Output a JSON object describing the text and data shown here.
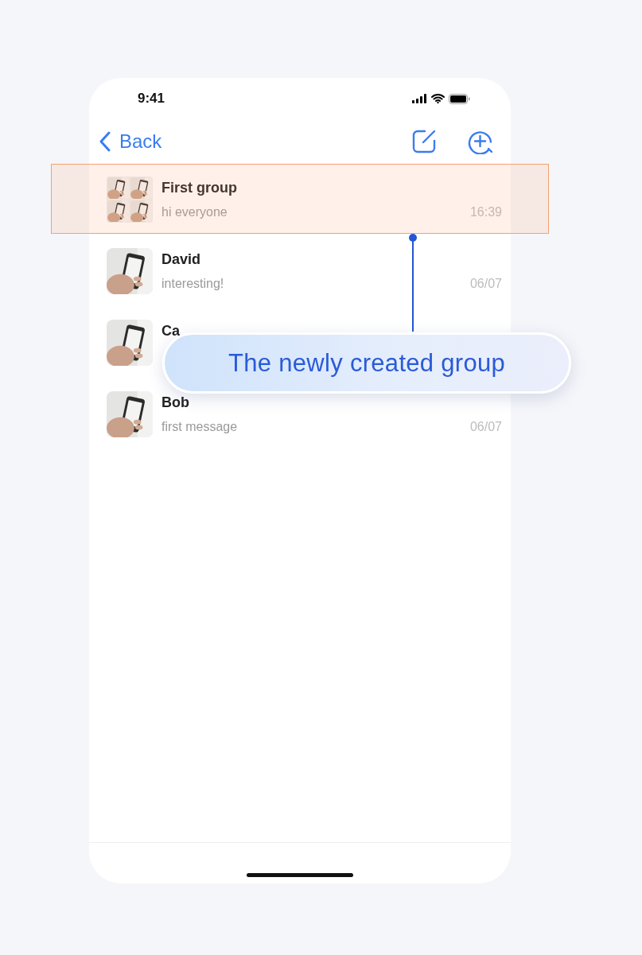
{
  "status_bar": {
    "time": "9:41"
  },
  "nav": {
    "back_label": "Back"
  },
  "chats": [
    {
      "name": "First group",
      "message": "hi everyone",
      "time": "16:39",
      "kind": "group",
      "highlighted": true
    },
    {
      "name": "David",
      "message": "interesting!",
      "time": "06/07",
      "kind": "single",
      "highlighted": false
    },
    {
      "name": "Ca",
      "kind": "single",
      "highlighted": false
    },
    {
      "name": "Bob",
      "message": "first message",
      "time": "06/07",
      "kind": "single",
      "highlighted": false
    }
  ],
  "callout": {
    "label": "The newly created group"
  }
}
